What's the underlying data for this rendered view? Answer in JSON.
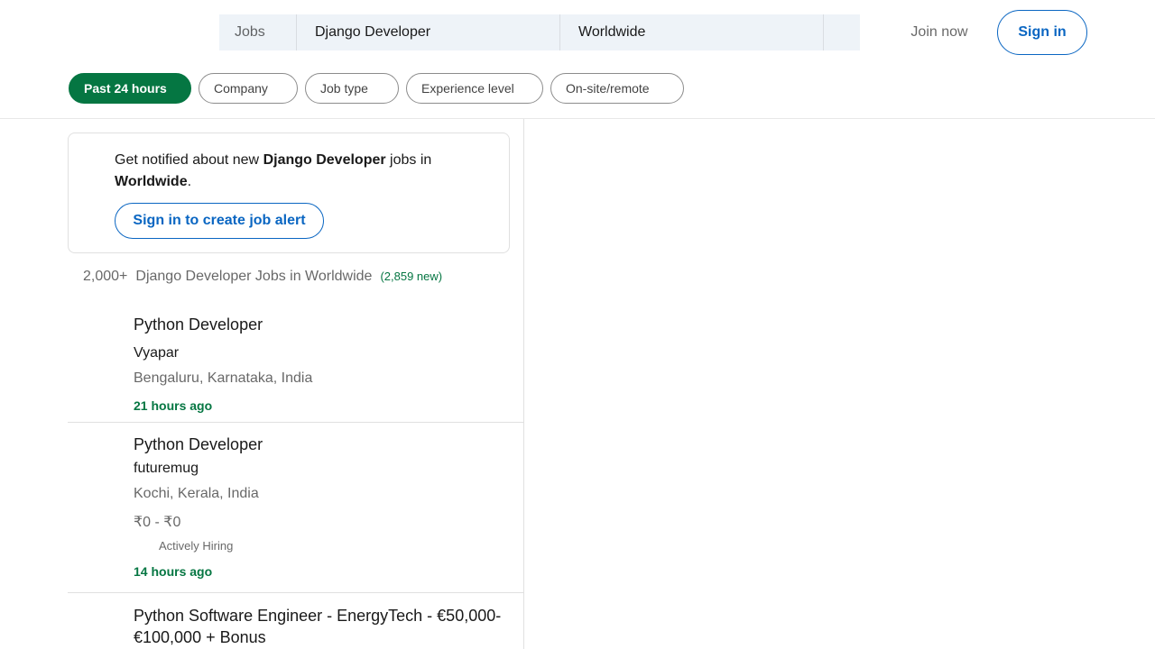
{
  "search": {
    "type_label": "Jobs",
    "keyword": "Django Developer",
    "location": "Worldwide"
  },
  "nav": {
    "join_now": "Join now",
    "sign_in": "Sign in"
  },
  "filters": [
    {
      "label": "Past 24 hours",
      "active": true
    },
    {
      "label": "Company",
      "active": false
    },
    {
      "label": "Job type",
      "active": false
    },
    {
      "label": "Experience level",
      "active": false
    },
    {
      "label": "On-site/remote",
      "active": false
    }
  ],
  "alert": {
    "prefix": "Get notified about new ",
    "keyword": "Django Developer",
    "middle": " jobs in ",
    "location": "Worldwide",
    "suffix": ".",
    "button": "Sign in to create job alert"
  },
  "results": {
    "count": "2,000+",
    "label": "Django Developer Jobs in Worldwide",
    "new_count": "(2,859 new)"
  },
  "jobs": [
    {
      "title": "Python Developer",
      "company": "Vyapar",
      "location": "Bengaluru, Karnataka, India",
      "posted": "21 hours ago"
    },
    {
      "title": "Python Developer",
      "company": "futuremug",
      "location": "Kochi, Kerala, India",
      "salary": "₹0 - ₹0",
      "badge": "Actively Hiring",
      "posted": "14 hours ago"
    },
    {
      "title": "Python Software Engineer - EnergyTech - €50,000-€100,000 + Bonus"
    }
  ],
  "colors": {
    "brand_blue": "#0a66c2",
    "green": "#057642",
    "search_bg": "#eef3f8"
  }
}
